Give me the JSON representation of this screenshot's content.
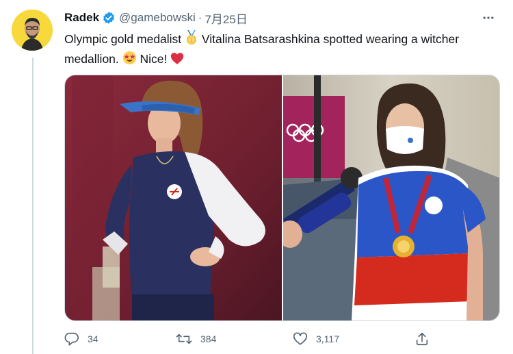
{
  "tweet": {
    "display_name": "Radek",
    "handle": "@gamebowski",
    "separator": "·",
    "date": "7月25日",
    "text_part1": "Olympic gold medalist",
    "text_part2": "Vitalina Batsarashkina spotted wearing a witcher medallion.",
    "text_part3": "Nice!",
    "emojis": [
      "gold-medal",
      "star-struck",
      "red-heart"
    ]
  },
  "actions": {
    "reply_count": "34",
    "retweet_count": "384",
    "like_count": "3,117"
  },
  "colors": {
    "accent": "#1d9bf0",
    "muted": "#536471",
    "avatar_bg": "#f7d93c",
    "heart": "#e0245e"
  }
}
